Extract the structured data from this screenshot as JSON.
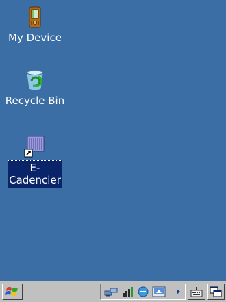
{
  "desktop": {
    "icons": [
      {
        "label": "My Device",
        "icon": "pda-icon"
      },
      {
        "label": "Recycle Bin",
        "icon": "recycle-bin-icon"
      },
      {
        "label_line1": "E-",
        "label_line2": "Cadencier",
        "icon": "shortcut-app-icon",
        "selected": true
      }
    ]
  },
  "taskbar": {
    "start_icon": "windows-flag-icon",
    "tray_icons": [
      "network-icon",
      "signal-icon",
      "browser-icon",
      "connection-icon",
      "tray-expand-arrow-icon"
    ],
    "buttons": [
      "keyboard-icon",
      "switch-windows-icon"
    ]
  },
  "colors": {
    "desktop": "#3a6ea5",
    "taskbar": "#c0c0c0",
    "selection": "#0a246a"
  }
}
